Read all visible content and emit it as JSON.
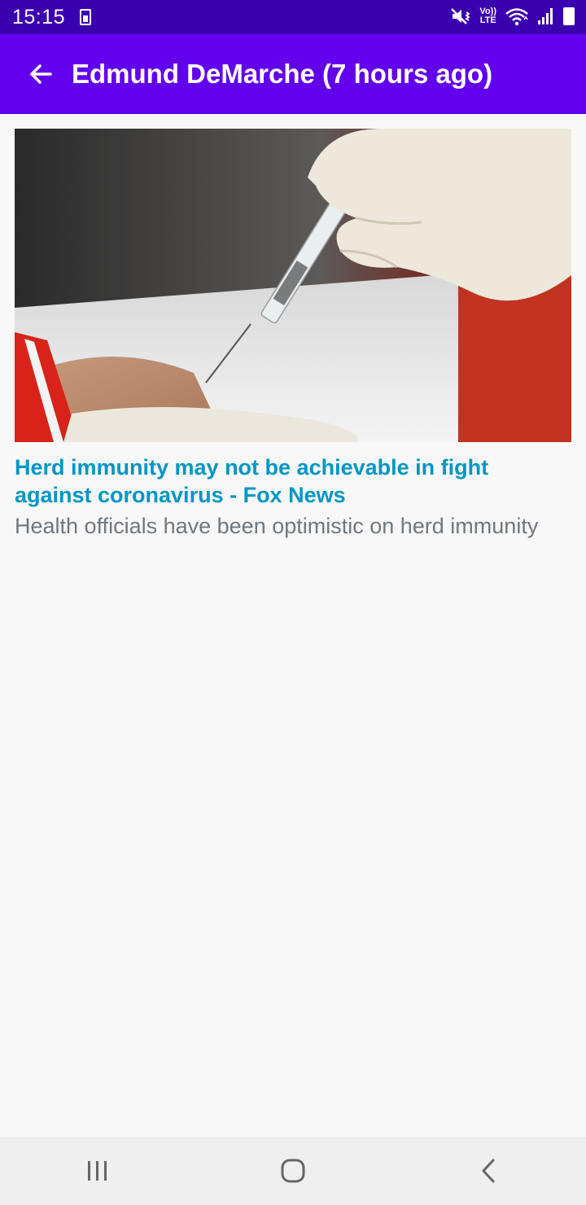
{
  "status_bar": {
    "time": "15:15",
    "icons": [
      "battery-saver-icon",
      "mute-vibrate-icon",
      "volte-icon",
      "wifi-icon",
      "signal-icon",
      "battery-icon"
    ],
    "volte_top": "Vo))",
    "volte_bottom": "LTE"
  },
  "app_bar": {
    "back_icon": "arrow-back-icon",
    "title": "Edmund DeMarche (7 hours ago)",
    "color": "#6200ee"
  },
  "article": {
    "image_icon": "vaccine-syringe-photo",
    "headline": "Herd immunity may not be achievable in fight against coronavirus - Fox News",
    "summary": "Health officials have been optimistic on herd immunity",
    "headline_color": "#0096c7"
  },
  "nav_bar": {
    "items": [
      "recent-apps-icon",
      "home-icon",
      "back-icon"
    ]
  }
}
